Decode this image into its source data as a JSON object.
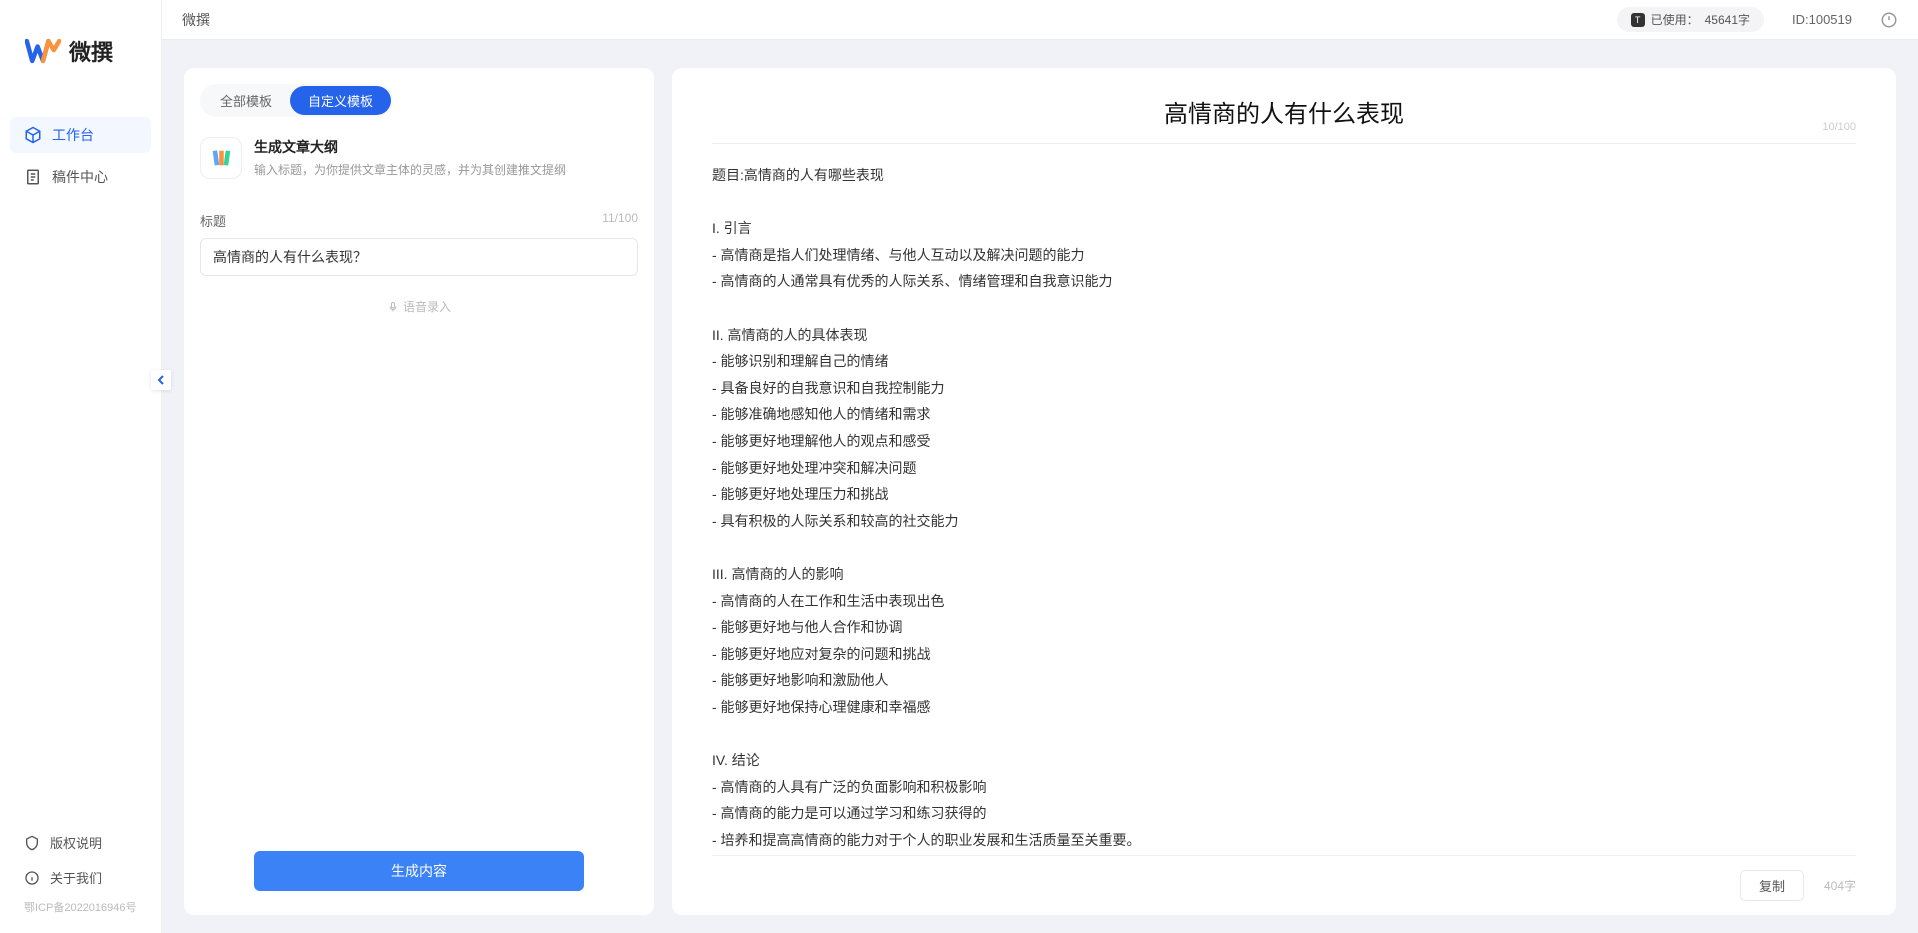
{
  "app_name": "微撰",
  "topbar": {
    "title": "微撰",
    "usage_prefix": "已使用：",
    "usage_value": "45641字",
    "user_id": "ID:100519"
  },
  "sidebar": {
    "nav": [
      {
        "label": "工作台",
        "active": true
      },
      {
        "label": "稿件中心",
        "active": false
      }
    ],
    "bottom": [
      {
        "label": "版权说明"
      },
      {
        "label": "关于我们"
      }
    ],
    "icp": "鄂ICP备2022016946号"
  },
  "tabs": {
    "all": "全部模板",
    "custom": "自定义模板"
  },
  "template": {
    "name": "生成文章大纲",
    "desc": "输入标题，为你提供文章主体的灵感，并为其创建推文提纲"
  },
  "form": {
    "label": "标题",
    "count": "11/100",
    "value": "高情商的人有什么表现？",
    "voice": "语音录入",
    "generate": "生成内容"
  },
  "output": {
    "title": "高情商的人有什么表现",
    "title_count": "10/100",
    "body": "题目:高情商的人有哪些表现\n\nI. 引言\n- 高情商是指人们处理情绪、与他人互动以及解决问题的能力\n- 高情商的人通常具有优秀的人际关系、情绪管理和自我意识能力\n\nII. 高情商的人的具体表现\n- 能够识别和理解自己的情绪\n- 具备良好的自我意识和自我控制能力\n- 能够准确地感知他人的情绪和需求\n- 能够更好地理解他人的观点和感受\n- 能够更好地处理冲突和解决问题\n- 能够更好地处理压力和挑战\n- 具有积极的人际关系和较高的社交能力\n\nIII. 高情商的人的影响\n- 高情商的人在工作和生活中表现出色\n- 能够更好地与他人合作和协调\n- 能够更好地应对复杂的问题和挑战\n- 能够更好地影响和激励他人\n- 能够更好地保持心理健康和幸福感\n\nIV. 结论\n- 高情商的人具有广泛的负面影响和积极影响\n- 高情商的能力是可以通过学习和练习获得的\n- 培养和提高高情商的能力对于个人的职业发展和生活质量至关重要。",
    "copy": "复制",
    "word_count": "404字"
  }
}
